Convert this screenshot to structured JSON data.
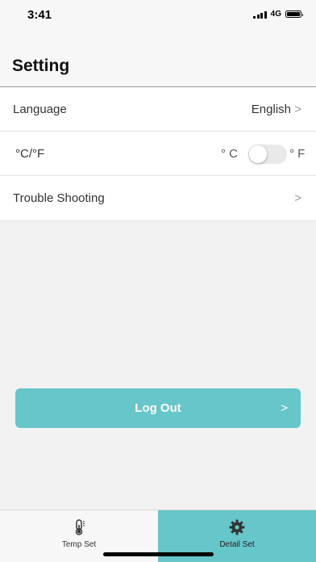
{
  "status_bar": {
    "time": "3:41",
    "network": "4G",
    "icons": [
      "signal-icon",
      "battery-icon"
    ]
  },
  "header": {
    "title": "Setting"
  },
  "settings": {
    "language": {
      "label": "Language",
      "value": "English",
      "chevron": ">"
    },
    "units": {
      "label": "°C/°F",
      "celsius": "° C",
      "fahrenheit": "° F",
      "toggle_on": false
    },
    "trouble": {
      "label": "Trouble Shooting",
      "chevron": ">"
    }
  },
  "logout": {
    "label": "Log Out",
    "chevron": ">"
  },
  "tabs": [
    {
      "label": "Temp Set",
      "icon": "thermometer-icon",
      "active": false
    },
    {
      "label": "Detail Set",
      "icon": "gear-icon",
      "active": true
    }
  ],
  "colors": {
    "accent": "#66c6c9",
    "background": "#f2f2f2"
  }
}
